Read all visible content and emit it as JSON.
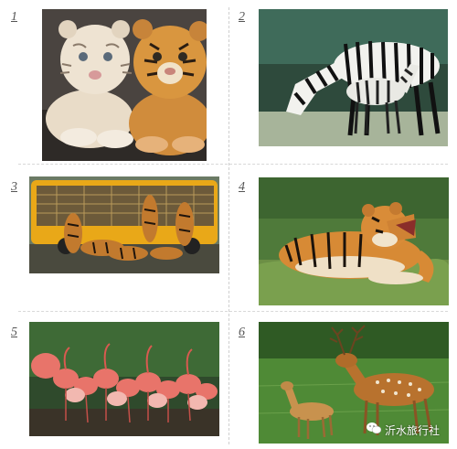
{
  "grid": {
    "items": [
      {
        "number": "1",
        "subject": "tiger cubs"
      },
      {
        "number": "2",
        "subject": "zebras"
      },
      {
        "number": "3",
        "subject": "tigers at bus"
      },
      {
        "number": "4",
        "subject": "lying tiger"
      },
      {
        "number": "5",
        "subject": "flamingos"
      },
      {
        "number": "6",
        "subject": "deer"
      }
    ]
  },
  "watermark": {
    "text": "沂水旅行社",
    "icon": "wechat-icon"
  }
}
